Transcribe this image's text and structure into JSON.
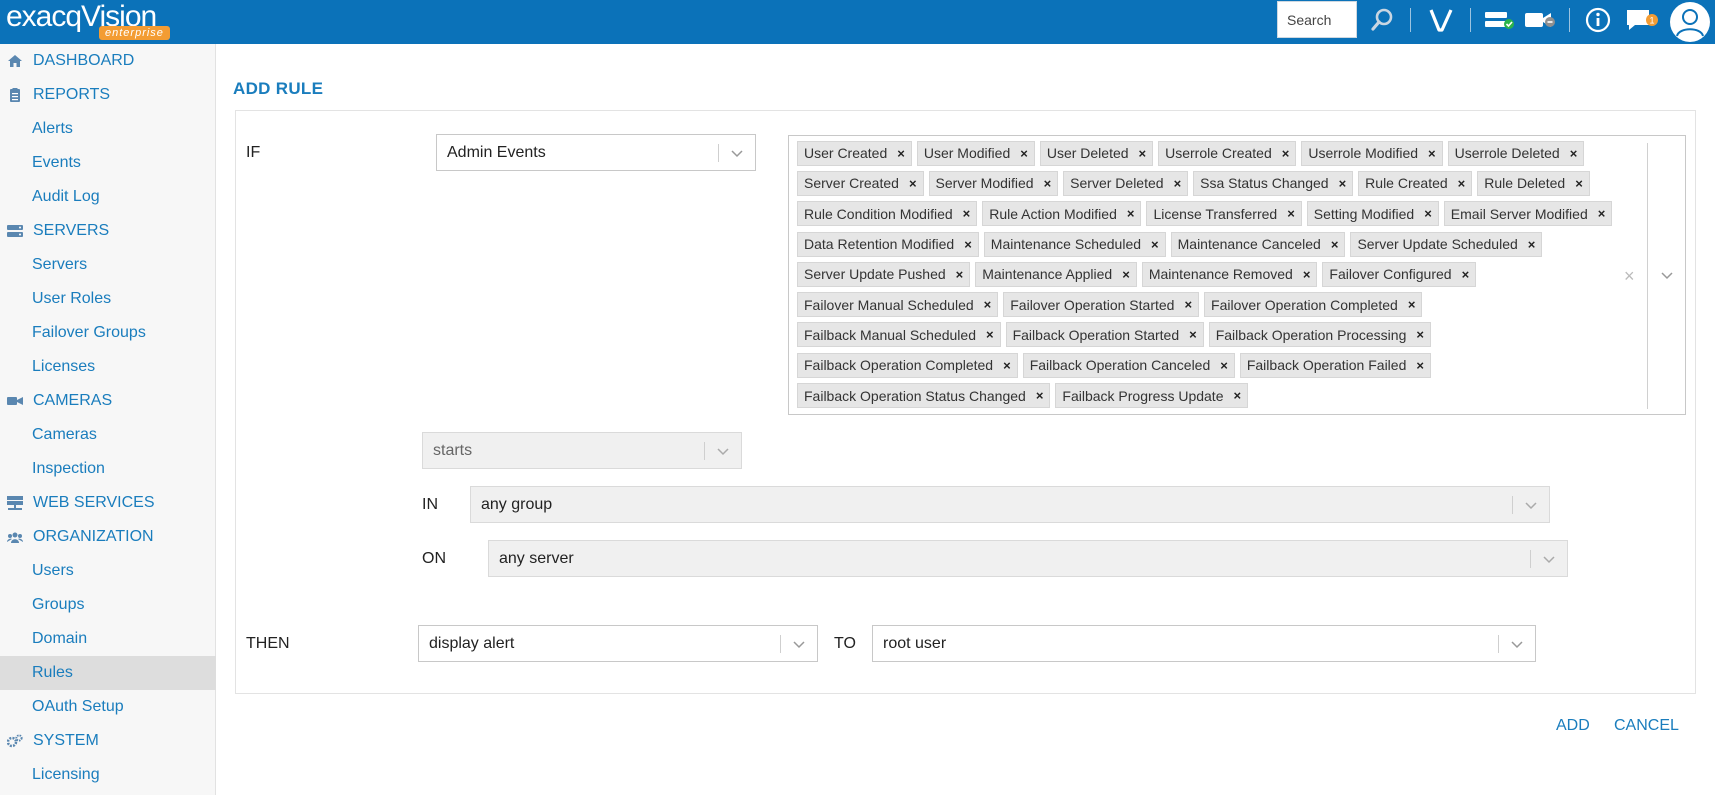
{
  "header": {
    "logo_main": "exacqVision",
    "logo_sub": "enterprise",
    "search_label": "Search",
    "notification_count": "1"
  },
  "sidebar": {
    "items": [
      {
        "label": "DASHBOARD",
        "kind": "section",
        "icon": "home-icon"
      },
      {
        "label": "REPORTS",
        "kind": "section",
        "icon": "clipboard-icon"
      },
      {
        "label": "Alerts",
        "kind": "sub"
      },
      {
        "label": "Events",
        "kind": "sub"
      },
      {
        "label": "Audit Log",
        "kind": "sub"
      },
      {
        "label": "SERVERS",
        "kind": "section",
        "icon": "server-icon"
      },
      {
        "label": "Servers",
        "kind": "sub"
      },
      {
        "label": "User Roles",
        "kind": "sub"
      },
      {
        "label": "Failover Groups",
        "kind": "sub"
      },
      {
        "label": "Licenses",
        "kind": "sub"
      },
      {
        "label": "CAMERAS",
        "kind": "section",
        "icon": "video-camera-icon"
      },
      {
        "label": "Cameras",
        "kind": "sub"
      },
      {
        "label": "Inspection",
        "kind": "sub"
      },
      {
        "label": "WEB SERVICES",
        "kind": "section",
        "icon": "network-icon"
      },
      {
        "label": "ORGANIZATION",
        "kind": "section",
        "icon": "users-icon"
      },
      {
        "label": "Users",
        "kind": "sub"
      },
      {
        "label": "Groups",
        "kind": "sub"
      },
      {
        "label": "Domain",
        "kind": "sub"
      },
      {
        "label": "Rules",
        "kind": "sub",
        "active": true
      },
      {
        "label": "OAuth Setup",
        "kind": "sub"
      },
      {
        "label": "SYSTEM",
        "kind": "section",
        "icon": "cogs-icon"
      },
      {
        "label": "Licensing",
        "kind": "sub"
      }
    ]
  },
  "main": {
    "title": "ADD RULE",
    "if_label": "IF",
    "event_type": "Admin Events",
    "event_tags": [
      [
        "User Created",
        "User Modified",
        "User Deleted",
        "Userrole Created",
        "Userrole Modified",
        "Userrole Deleted"
      ],
      [
        "Server Created",
        "Server Modified",
        "Server Deleted",
        "Ssa Status Changed",
        "Rule Created",
        "Rule Deleted"
      ],
      [
        "Rule Condition Modified",
        "Rule Action Modified",
        "License Transferred",
        "Setting Modified",
        "Email Server Modified"
      ],
      [
        "Data Retention Modified",
        "Maintenance Scheduled",
        "Maintenance Canceled",
        "Server Update Scheduled"
      ],
      [
        "Server Update Pushed",
        "Maintenance Applied",
        "Maintenance Removed",
        "Failover Configured"
      ],
      [
        "Failover Manual Scheduled",
        "Failover Operation Started",
        "Failover Operation Completed"
      ],
      [
        "Failback Manual Scheduled",
        "Failback Operation Started",
        "Failback Operation Processing"
      ],
      [
        "Failback Operation Completed",
        "Failback Operation Canceled",
        "Failback Operation Failed"
      ],
      [
        "Failback Operation Status Changed",
        "Failback Progress Update"
      ]
    ],
    "tag_remove": "×",
    "clear_all": "×",
    "condition": "starts",
    "in_label": "IN",
    "in_value": "any group",
    "on_label": "ON",
    "on_value": "any server",
    "then_label": "THEN",
    "then_value": "display alert",
    "to_label": "TO",
    "to_value": "root user",
    "add_label": "ADD",
    "cancel_label": "CANCEL"
  },
  "colors": {
    "brand_blue": "#0b72b9",
    "link_blue": "#1a7dbd",
    "logo_orange": "#f39c33"
  }
}
